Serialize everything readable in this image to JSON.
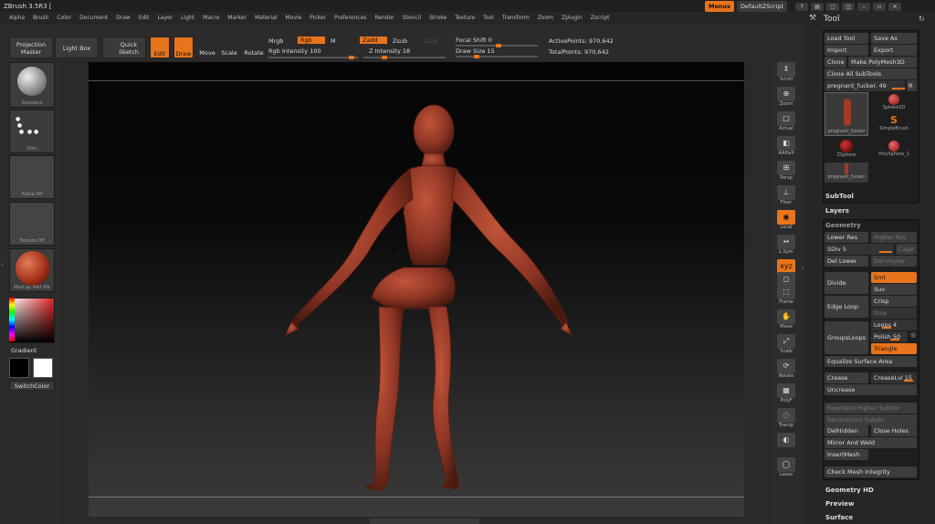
{
  "app": {
    "title": "ZBrush 3.5R3 ["
  },
  "menu": [
    "Alpha",
    "Brush",
    "Color",
    "Document",
    "Draw",
    "Edit",
    "Layer",
    "Light",
    "Macro",
    "Marker",
    "Material",
    "Movie",
    "Picker",
    "Preferences",
    "Render",
    "Stencil",
    "Stroke",
    "Texture",
    "Tool",
    "Transform",
    "Zoom",
    "Zplugin",
    "Zscript"
  ],
  "topright": {
    "menus": "Menus",
    "script": "DefaultZScript"
  },
  "toolbar": {
    "projection_master": "Projection Master",
    "light_box": "Light Box",
    "quick_sketch": "Quick Sketch",
    "edit": "Edit",
    "draw": "Draw",
    "move": "Move",
    "scale": "Scale",
    "rotate": "Rotate",
    "mrgb": "Mrgb",
    "rgb": "Rgb",
    "m": "M",
    "rgb_intensity": "Rgb Intensity 100",
    "zadd": "Zadd",
    "zsub": "Zsub",
    "zcut": "Zcut",
    "z_intensity": "Z Intensity 18",
    "focal_shift": "Focal Shift 0",
    "draw_size": "Draw Size 15",
    "active_points": "ActivePoints: 970,642",
    "total_points": "TotalPoints: 970,642"
  },
  "left": {
    "brush": "Standard",
    "stroke": "Dots",
    "alpha": "Alpha Off",
    "texture": "Texture Off",
    "material": "MatCap Red Wa",
    "gradient": "Gradient",
    "switch_color": "SwitchColor"
  },
  "rightstrip": [
    "Scroll",
    "Zoom",
    "Actual",
    "AAHalf",
    "Persp",
    "Floor",
    "Local",
    "L.Sym",
    "XYZ",
    "",
    "Frame",
    "Move",
    "Scale",
    "Rotate",
    "PolyF",
    "Transp",
    "",
    "Lasso"
  ],
  "tool": {
    "title": "Tool",
    "load_tool": "Load Tool",
    "save_as": "Save As",
    "import": "Import",
    "export": "Export",
    "clone": "Clone",
    "make_polymesh": "Make PolyMesh3D",
    "clone_all": "Clone All SubTools",
    "current_tool": "pregnant_fucker. 49",
    "r": "R",
    "thumbs": [
      "pregnant_fucker",
      "Sphere3D",
      "SimpleBrush",
      "ZSphere",
      "PolySphere_1",
      "pregnant_fucker"
    ],
    "subtool": "SubTool",
    "layers": "Layers",
    "geometry": "Geometry",
    "lower_res": "Lower Res",
    "higher_res": "Higher Res",
    "sdiv": "SDiv 5",
    "cage": "Cage",
    "del_lower": "Del Lower",
    "del_higher": "Del Higher",
    "divide": "Divide",
    "smt": "Smt",
    "suv": "Suv",
    "edge_loop": "Edge Loop",
    "crisp": "Crisp",
    "disp": "Disp",
    "groups_loops": "GroupsLoops",
    "loops": "Loops 4",
    "polish": "Polish 50",
    "triangle": "Triangle",
    "equalize": "Equalize Surface Area",
    "crease": "Crease",
    "crease_lvl": "CreaseLvl 15",
    "uncrease": "Uncrease",
    "reproject": "Reproject Higher Subdiv",
    "reconstruct": "Reconstruct Subdiv",
    "delhidden": "DelHidden",
    "close_holes": "Close Holes",
    "mirror_weld": "Mirror And Weld",
    "insertmesh": "InsertMesh",
    "check_mesh": "Check Mesh Integrity",
    "geometry_hd": "Geometry HD",
    "preview": "Preview",
    "surface": "Surface"
  }
}
